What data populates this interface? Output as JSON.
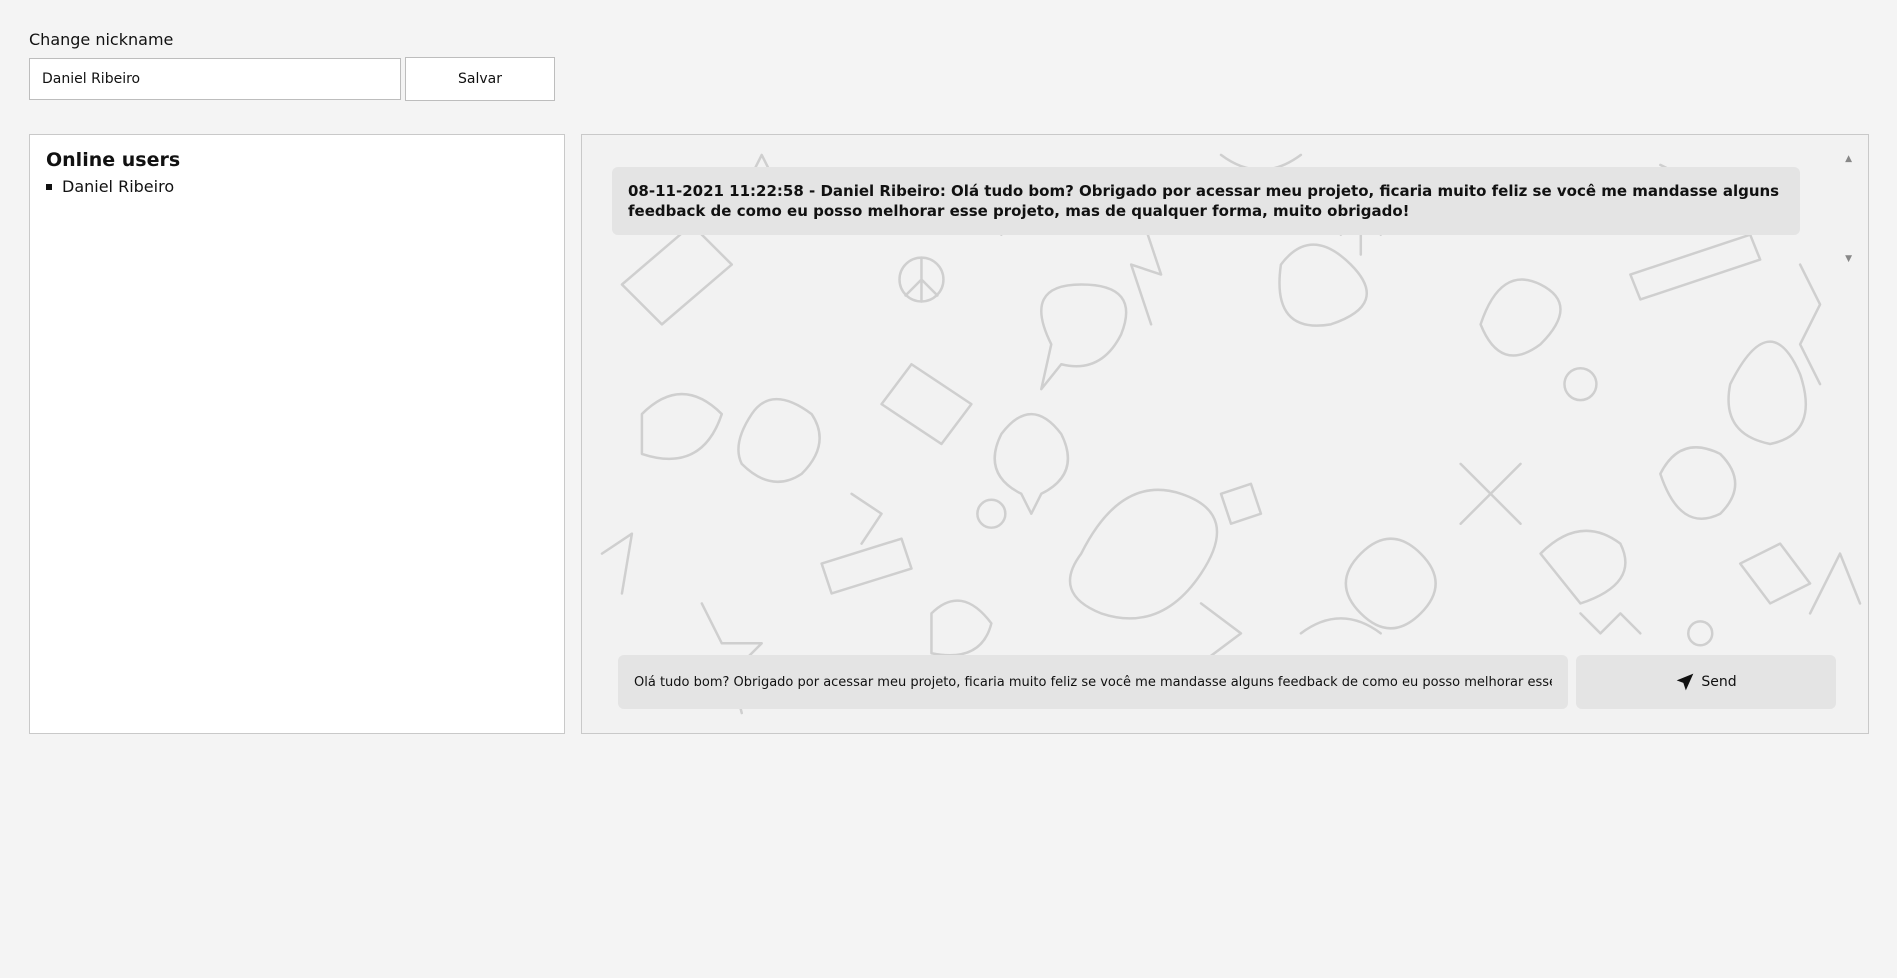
{
  "nickname": {
    "label": "Change nickname",
    "value": "Daniel Ribeiro",
    "save_label": "Salvar"
  },
  "online_users": {
    "title": "Online users",
    "users": [
      "Daniel Ribeiro"
    ]
  },
  "chat": {
    "messages": [
      "08-11-2021 11:22:58 - Daniel Ribeiro: Olá tudo bom? Obrigado por acessar meu projeto, ficaria muito feliz se você me mandasse alguns feedback de como eu posso melhorar esse projeto, mas de qualquer forma, muito obrigado!"
    ],
    "input_value": "Olá tudo bom? Obrigado por acessar meu projeto, ficaria muito feliz se você me mandasse alguns feedback de como eu posso melhorar esse projeto, mas de qualquer forma, muito obrigado!",
    "send_label": "Send",
    "send_icon": "paper-plane-icon"
  },
  "colors": {
    "page_bg": "#f4f4f4",
    "panel_bg": "#ffffff",
    "bubble_bg": "#e4e4e4",
    "border": "#c9c9c9"
  }
}
